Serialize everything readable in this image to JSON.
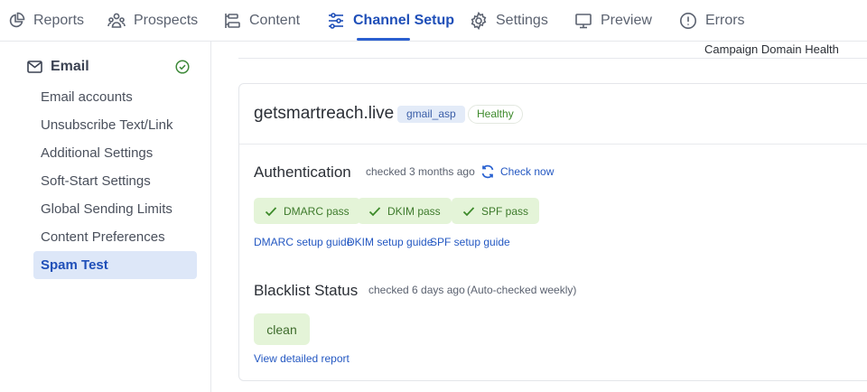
{
  "nav": {
    "tabs": [
      {
        "label": "Reports",
        "icon": "pie-chart-icon"
      },
      {
        "label": "Prospects",
        "icon": "users-icon"
      },
      {
        "label": "Content",
        "icon": "flow-icon"
      },
      {
        "label": "Channel Setup",
        "icon": "sliders-icon",
        "active": true
      },
      {
        "label": "Settings",
        "icon": "gear-icon"
      },
      {
        "label": "Preview",
        "icon": "monitor-icon"
      },
      {
        "label": "Errors",
        "icon": "alert-circle-icon"
      }
    ]
  },
  "sidebar": {
    "heading": "Email",
    "heading_icon": "mail-icon",
    "status_icon": "check-circle-icon",
    "items": [
      {
        "label": "Email accounts"
      },
      {
        "label": "Unsubscribe Text/Link"
      },
      {
        "label": "Additional Settings"
      },
      {
        "label": "Soft-Start Settings"
      },
      {
        "label": "Global Sending Limits"
      },
      {
        "label": "Content Preferences"
      },
      {
        "label": "Spam Test",
        "active": true
      }
    ]
  },
  "header_link": "Campaign Domain Health",
  "domain_card": {
    "domain": "getsmartreach.live",
    "provider_badge": "gmail_asp",
    "health_badge": "Healthy",
    "authentication": {
      "title": "Authentication",
      "checked": "checked 3 months ago",
      "check_now": "Check now",
      "results": [
        "DMARC pass",
        "DKIM pass",
        "SPF pass"
      ],
      "guides": [
        "DMARC setup guide",
        "DKIM setup guide",
        "SPF setup guide"
      ]
    },
    "blacklist": {
      "title": "Blacklist Status",
      "checked": "checked 6 days ago",
      "auto_note": "(Auto-checked weekly)",
      "status": "clean",
      "report_link": "View detailed report"
    }
  },
  "colors": {
    "accent": "#1f4fb8",
    "active_bg": "#dde7f8",
    "pass_bg": "#e4f4d8",
    "pass_text": "#3d7a2b",
    "link": "#2458c2"
  }
}
